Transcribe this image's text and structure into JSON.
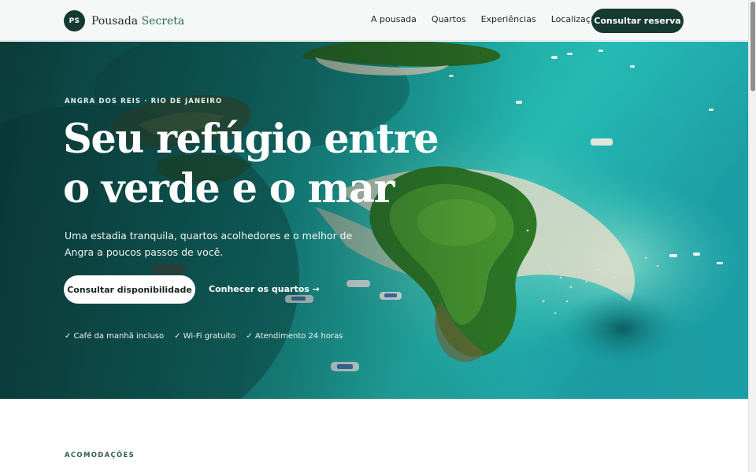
{
  "header": {
    "logo_initials": "PS",
    "brand_name": "Pousada",
    "brand_accent": "Secreta",
    "nav": [
      "A pousada",
      "Quartos",
      "Experiências",
      "Localização"
    ],
    "cta_label": "Consultar reserva"
  },
  "hero": {
    "eyebrow": "ANGRA DOS REIS · RIO DE JANEIRO",
    "title": "Seu refúgio entre o verde e o mar",
    "lede": "Uma estadia tranquila, quartos acolhedores e o melhor de Angra a poucos passos de você.",
    "primary_button": "Consultar disponibilidade",
    "secondary_link": "Conhecer os quartos →",
    "perks": [
      "✓ Café da manhã incluso",
      "✓ Wi-Fi gratuito",
      "✓ Atendimento 24 horas"
    ]
  },
  "section": {
    "label": "ACOMODAÇÕES"
  },
  "colors": {
    "brand_dark_green": "#163a30",
    "brand_accent_green": "#2a6b57",
    "header_bg": "#f6f8f7",
    "sea_turquoise": "#1fb3ad"
  },
  "icons": [
    "check-icon",
    "arrow-right-icon",
    "logo-badge"
  ]
}
